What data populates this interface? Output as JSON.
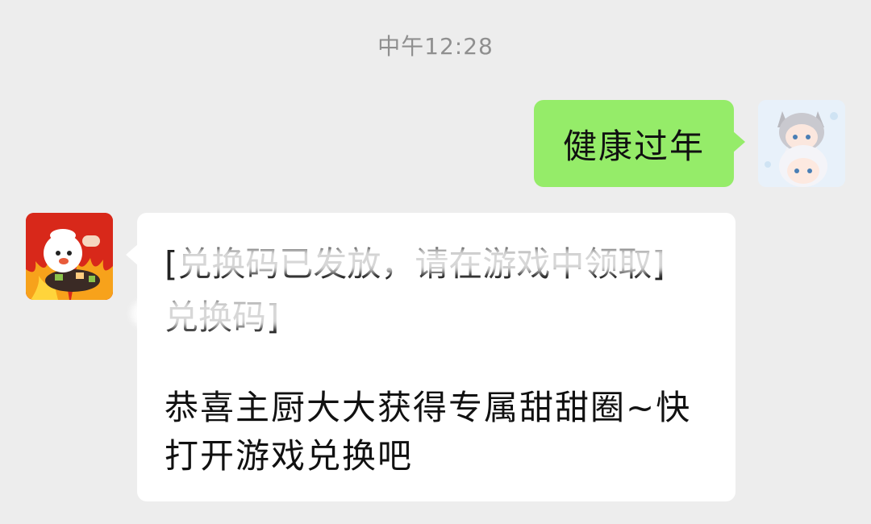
{
  "chat": {
    "timestamp": "中午12:28",
    "messages": [
      {
        "sender": "self",
        "avatar": "anime-cat-girls-avatar",
        "text": "健康过年"
      },
      {
        "sender": "other",
        "avatar": "game-chef-avatar",
        "obscured_line_1": "[兑换码已发放，请在游戏中领取]",
        "obscured_line_2": "兑换码]",
        "text": "恭喜主厨大大获得专属甜甜圈~快打开游戏兑换吧"
      }
    ]
  },
  "colors": {
    "background": "#ededed",
    "outgoing_bubble": "#95ec69",
    "incoming_bubble": "#ffffff",
    "timestamp_text": "#8f8f8f"
  }
}
